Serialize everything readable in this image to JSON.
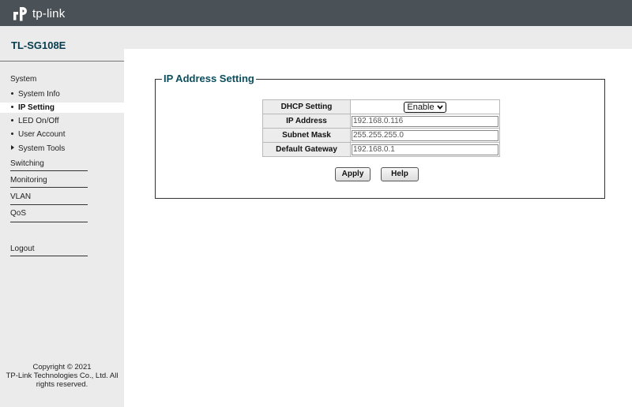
{
  "brand": {
    "logo_text": "tp-link"
  },
  "device": {
    "model": "TL-SG108E"
  },
  "sidebar": {
    "system_label": "System",
    "items": [
      {
        "label": "System Info"
      },
      {
        "label": "IP Setting"
      },
      {
        "label": "LED On/Off"
      },
      {
        "label": "User Account"
      },
      {
        "label": "System Tools"
      }
    ],
    "sections": [
      {
        "label": "Switching"
      },
      {
        "label": "Monitoring"
      },
      {
        "label": "VLAN"
      },
      {
        "label": "QoS"
      }
    ],
    "logout_label": "Logout",
    "copyright": [
      "Copyright © 2021",
      "TP-Link Technologies Co., Ltd. All",
      "rights reserved."
    ]
  },
  "main": {
    "section_title": "IP Address Setting",
    "fields": {
      "dhcp_label": "DHCP Setting",
      "dhcp_value": "Enable",
      "ip_label": "IP Address",
      "ip_value": "192.168.0.116",
      "mask_label": "Subnet Mask",
      "mask_value": "255.255.255.0",
      "gateway_label": "Default Gateway",
      "gateway_value": "192.168.0.1"
    },
    "apply_label": "Apply",
    "help_label": "Help"
  },
  "colors": {
    "topbar": "#4a5157",
    "sidebar": "#ebebeb",
    "title": "#0b4e5e"
  }
}
